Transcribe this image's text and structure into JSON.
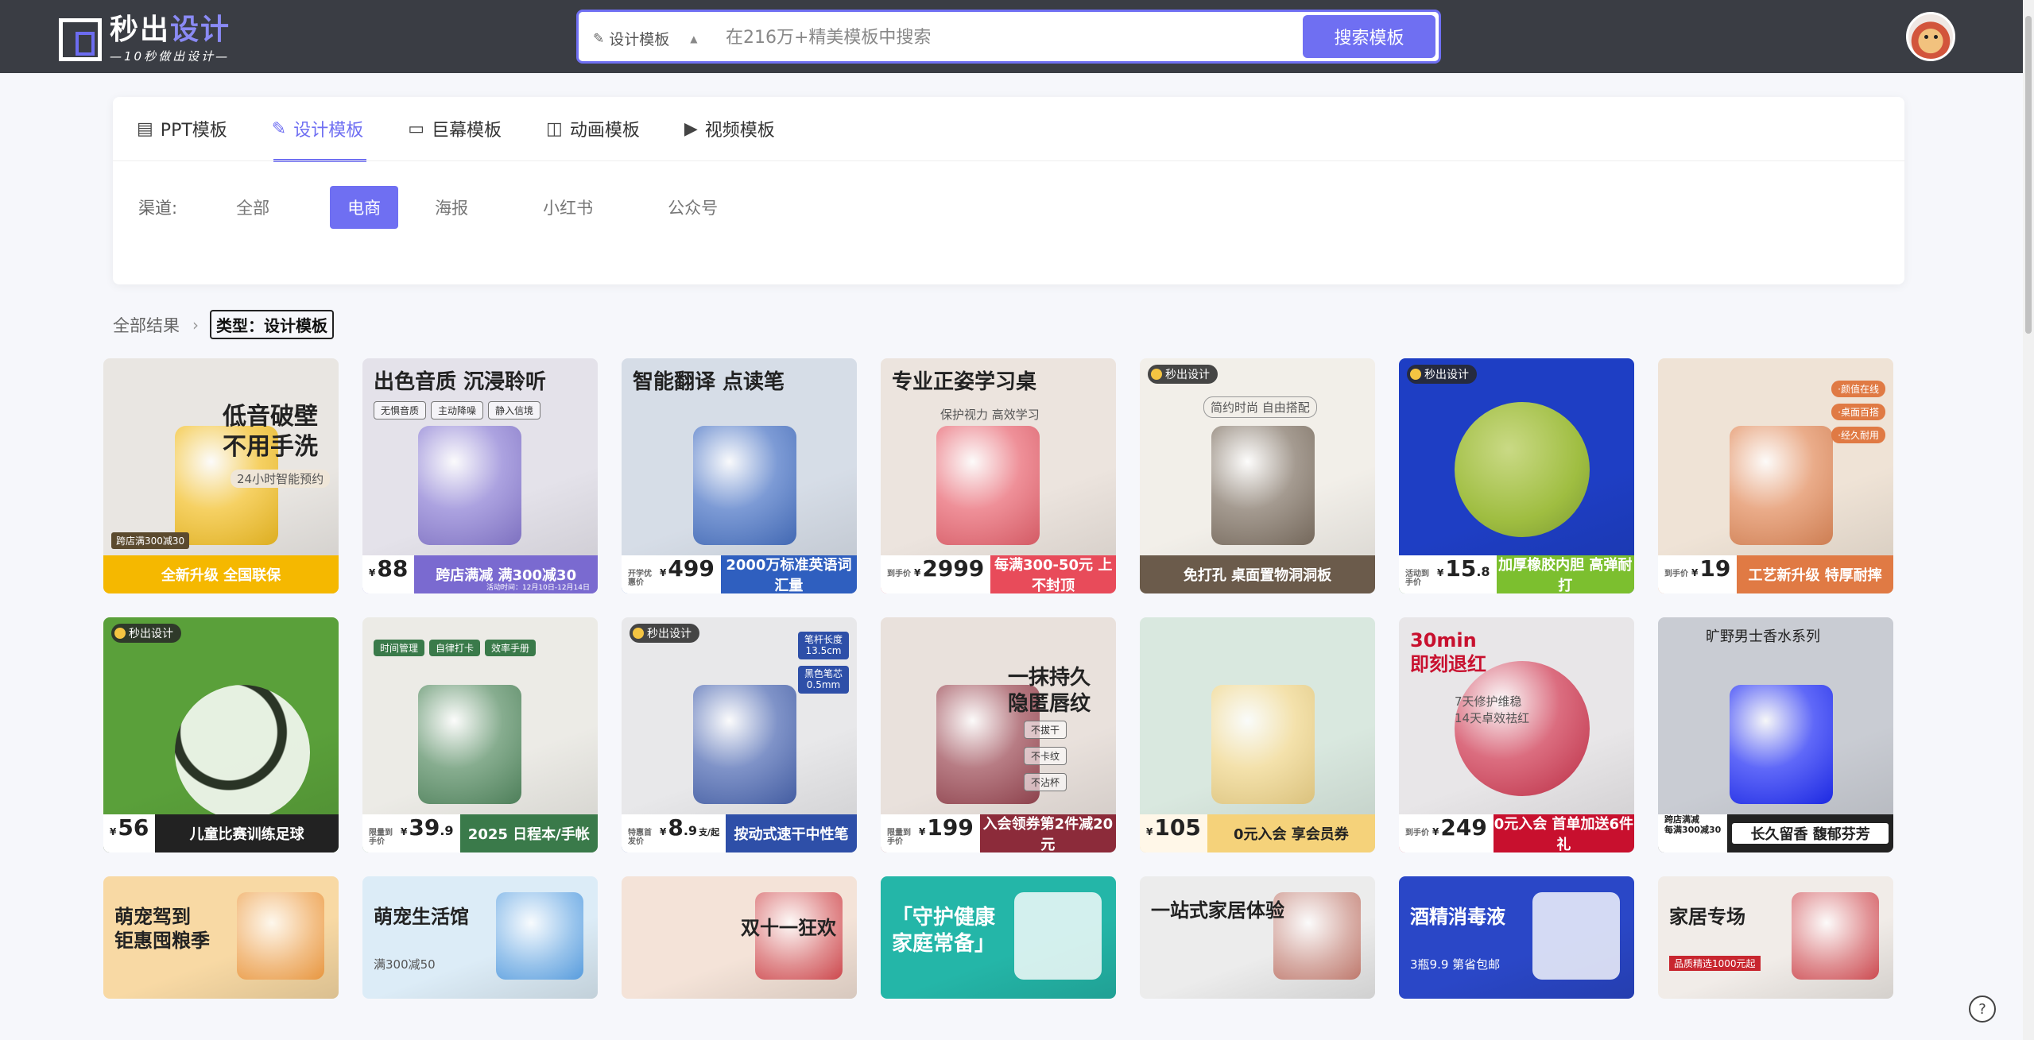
{
  "header": {
    "logo_main": "秒出",
    "logo_accent": "设计",
    "logo_sub": "—10秒做出设计—",
    "search_type": "设计模板",
    "search_placeholder": "在216万+精美模板中搜索",
    "search_button": "搜索模板"
  },
  "tabs": [
    {
      "label": "PPT模板",
      "icon": "ppt-icon"
    },
    {
      "label": "设计模板",
      "icon": "design-icon",
      "active": true
    },
    {
      "label": "巨幕模板",
      "icon": "screen-icon"
    },
    {
      "label": "动画模板",
      "icon": "animation-icon"
    },
    {
      "label": "视频模板",
      "icon": "video-icon"
    }
  ],
  "channel": {
    "label": "渠道:",
    "options": [
      "全部",
      "电商",
      "海报",
      "小红书",
      "公众号"
    ],
    "active": "电商"
  },
  "breadcrumb": {
    "root": "全部结果",
    "tag": "类型：设计模板"
  },
  "cards": [
    {
      "title": "低音破壁\n不用手洗",
      "sub": "24小时智能预约",
      "corner": "跨店满300减30",
      "banner": "全新升级 全国联保",
      "colors": [
        "#e9e6e2",
        "#f5b800"
      ]
    },
    {
      "title": "出色音质 沉浸聆听",
      "chips": [
        "无惧音质",
        "主动降噪",
        "静入信境"
      ],
      "price": "88",
      "banner": "跨店满减 满300减30",
      "note": "活动时间：12月10日-12月14日",
      "colors": [
        "#e4e2ea",
        "#7a6ad0"
      ]
    },
    {
      "title": "智能翻译 点读笔",
      "price_label": "开学优惠价",
      "price": "499",
      "banner": "2000万标准英语词汇量",
      "colors": [
        "#d6dde7",
        "#2f5fbf"
      ]
    },
    {
      "title": "专业正姿学习桌",
      "sub": "保护视力 高效学习",
      "price_label": "到手价",
      "price": "2999",
      "banner": "每满300-50元 上不封顶",
      "colors": [
        "#ece4de",
        "#e84b5a"
      ]
    },
    {
      "brand": "秒出设计",
      "sub": "简约时尚 自由搭配",
      "banner": "免打孔 桌面置物洞洞板",
      "colors": [
        "#f2efe9",
        "#6b5b4b"
      ]
    },
    {
      "brand": "秒出设计",
      "price_label": "活动到手价",
      "price": "15",
      "price_dec": ".8",
      "banner": "加厚橡胶内胆 高弹耐打",
      "colors": [
        "#1e3ec4",
        "#7cbf2f"
      ]
    },
    {
      "labels": [
        "·颜值在线",
        "·桌面百搭",
        "·经久耐用"
      ],
      "price_label": "到手价",
      "price": "19",
      "banner": "工艺新升级 特厚耐摔",
      "colors": [
        "#efe3d6",
        "#e07a44"
      ]
    },
    {
      "brand": "秒出设计",
      "price": "56",
      "banner": "儿童比赛训练足球",
      "colors": [
        "#5aa03a",
        "#222"
      ]
    },
    {
      "chips": [
        "时间管理",
        "自律打卡",
        "效率手册"
      ],
      "price_label": "限量到手价",
      "price": "39",
      "price_dec": ".9",
      "banner": "2025 日程本/手帐",
      "colors": [
        "#ecebe6",
        "#3a7a4a"
      ]
    },
    {
      "brand": "秒出设计",
      "specs": [
        "笔杆长度\n13.5cm",
        "黑色笔芯\n0.5mm"
      ],
      "price_label": "特惠首发价",
      "price": "8",
      "price_dec": ".9",
      "unit": "支/起",
      "banner": "按动式速干中性笔",
      "colors": [
        "#e8e8ea",
        "#2e4fa8"
      ]
    },
    {
      "title": "一抹持久\n隐匿唇纹",
      "chips": [
        "不拔干",
        "不卡纹",
        "不沾杯"
      ],
      "price_label": "限量到手价",
      "price": "199",
      "banner": "入会领券第2件减20元",
      "colors": [
        "#e9e1dc",
        "#8c2b3a"
      ]
    },
    {
      "price": "105",
      "banner": "0元入会 享会员券",
      "colors": [
        "#d9e8df",
        "#f5d27a"
      ]
    },
    {
      "title": "30min\n即刻退红",
      "sub": "7天修护维稳\n14天卓效祛红",
      "price_label": "到手价",
      "price": "249",
      "banner": "0元入会 首单加送6件礼",
      "colors": [
        "#e8e6e8",
        "#c8102e"
      ]
    },
    {
      "title": "旷野男士香水系列",
      "price": "跨店满减\n每满300减30",
      "banner": "长久留香 馥郁芬芳",
      "colors": [
        "#c9ccd3",
        "#fff"
      ]
    },
    {
      "title": "萌宠驾到\n钜惠囤粮季",
      "colors": [
        "#f8d9a4",
        "#e98a2a"
      ]
    },
    {
      "title": "萌宠生活馆",
      "sub": "满300减50",
      "colors": [
        "#dcecf7",
        "#3b8ddc"
      ]
    },
    {
      "title": "双十一狂欢",
      "colors": [
        "#f4e3d8",
        "#c8262f"
      ]
    },
    {
      "title": "「守护健康\n家庭常备」",
      "colors": [
        "#24b6a8",
        "#ffffff"
      ]
    },
    {
      "title": "一站式家居体验",
      "colors": [
        "#ececec",
        "#b86152"
      ]
    },
    {
      "title": "酒精消毒液",
      "sub": "3瓶9.9 第省包邮",
      "colors": [
        "#2a47c7",
        "#ffffff"
      ]
    },
    {
      "title": "家居专场",
      "sub": "品质精选1000元起",
      "colors": [
        "#f1ece8",
        "#c8262f"
      ]
    }
  ],
  "help_label": "?"
}
